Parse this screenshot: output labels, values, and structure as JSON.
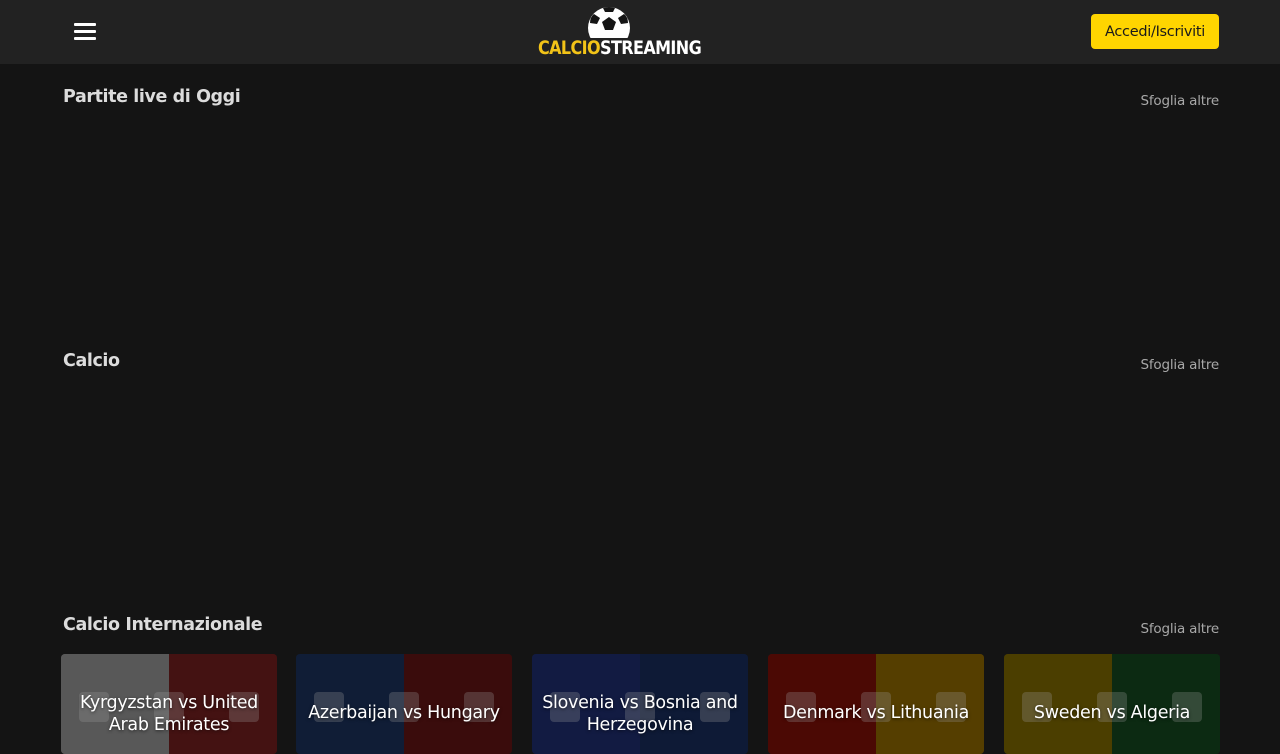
{
  "header": {
    "menu_icon": "hamburger-icon",
    "logo_icon": "soccer-ball-icon",
    "logo_part1": "CALCIO",
    "logo_part2": "STREAMING",
    "login_label": "Accedi/Iscriviti",
    "colors": {
      "accent": "#ffd500",
      "logo_yellow": "#f2c318",
      "bar": "#222222",
      "background": "#141414"
    }
  },
  "sections": [
    {
      "title": "Partite live di Oggi",
      "more": "Sfoglia altre"
    },
    {
      "title": "Calcio",
      "more": "Sfoglia altre"
    },
    {
      "title": "Calcio Internazionale",
      "more": "Sfoglia altre"
    }
  ],
  "matches": [
    {
      "title": "Kyrgyzstan vs United Arab Emirates",
      "left_color": "#8e8e8e",
      "right_color": "#6f1d1d"
    },
    {
      "title": "Azerbaijan vs Hungary",
      "left_color": "#1b2f57",
      "right_color": "#5e1414"
    },
    {
      "title": "Slovenia vs Bosnia and Herzegovina",
      "left_color": "#1d2c6b",
      "right_color": "#172a57"
    },
    {
      "title": "Denmark vs Lithuania",
      "left_color": "#7a1008",
      "right_color": "#8a6500"
    },
    {
      "title": "Sweden vs Algeria",
      "left_color": "#7a6400",
      "right_color": "#14441d"
    }
  ]
}
